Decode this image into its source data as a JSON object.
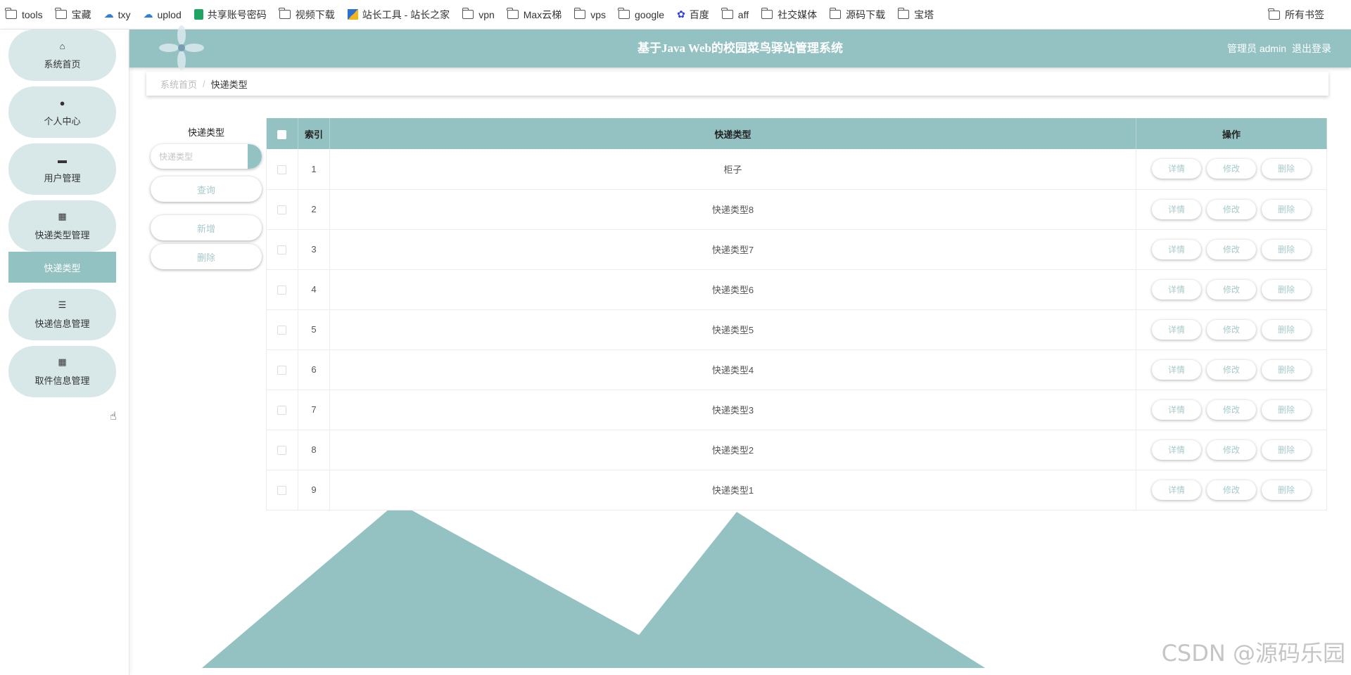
{
  "bookmarks": {
    "items": [
      {
        "label": "tools",
        "icon": "folder-icon"
      },
      {
        "label": "宝藏",
        "icon": "folder-icon"
      },
      {
        "label": "txy",
        "icon": "cloud-icon"
      },
      {
        "label": "uplod",
        "icon": "cloud-icon"
      },
      {
        "label": "共享账号密码",
        "icon": "sheet-icon"
      },
      {
        "label": "视频下载",
        "icon": "folder-icon"
      },
      {
        "label": "站长工具 - 站长之家",
        "icon": "tool-icon"
      },
      {
        "label": "vpn",
        "icon": "folder-icon"
      },
      {
        "label": "Max云梯",
        "icon": "folder-icon"
      },
      {
        "label": "vps",
        "icon": "folder-icon"
      },
      {
        "label": "google",
        "icon": "folder-icon"
      },
      {
        "label": "百度",
        "icon": "paw-icon"
      },
      {
        "label": "aff",
        "icon": "folder-icon"
      },
      {
        "label": "社交媒体",
        "icon": "folder-icon"
      },
      {
        "label": "源码下载",
        "icon": "folder-icon"
      },
      {
        "label": "宝塔",
        "icon": "folder-icon"
      }
    ],
    "all_bookmarks": "所有书签"
  },
  "sidebar": {
    "items": [
      {
        "label": "系统首页",
        "icon": "home-icon"
      },
      {
        "label": "个人中心",
        "icon": "user-icon"
      },
      {
        "label": "用户管理",
        "icon": "users-icon"
      },
      {
        "label": "快递类型管理",
        "icon": "grid-icon"
      },
      {
        "label": "快递信息管理",
        "icon": "list-icon"
      },
      {
        "label": "取件信息管理",
        "icon": "grid-icon"
      }
    ],
    "active_sub": "快递类型"
  },
  "header": {
    "title": "基于Java Web的校园菜鸟驿站管理系统",
    "admin": "管理员 admin",
    "logout": "退出登录"
  },
  "breadcrumb": {
    "home": "系统首页",
    "sep": "/",
    "current": "快递类型"
  },
  "search": {
    "label": "快递类型",
    "placeholder": "快递类型",
    "query_btn": "查询",
    "add_btn": "新增",
    "delete_btn": "删除"
  },
  "table": {
    "headers": {
      "index": "索引",
      "type": "快递类型",
      "ops": "操作"
    },
    "rows": [
      {
        "index": "1",
        "type": "柜子"
      },
      {
        "index": "2",
        "type": "快递类型8"
      },
      {
        "index": "3",
        "type": "快递类型7"
      },
      {
        "index": "4",
        "type": "快递类型6"
      },
      {
        "index": "5",
        "type": "快递类型5"
      },
      {
        "index": "6",
        "type": "快递类型4"
      },
      {
        "index": "7",
        "type": "快递类型3"
      },
      {
        "index": "8",
        "type": "快递类型2"
      },
      {
        "index": "9",
        "type": "快递类型1"
      }
    ],
    "op_labels": {
      "detail": "详情",
      "edit": "修改",
      "delete": "删除"
    }
  },
  "watermark": "CSDN @源码乐园",
  "colors": {
    "accent": "#94c2c3",
    "menu_bg": "#d8e8e8"
  }
}
